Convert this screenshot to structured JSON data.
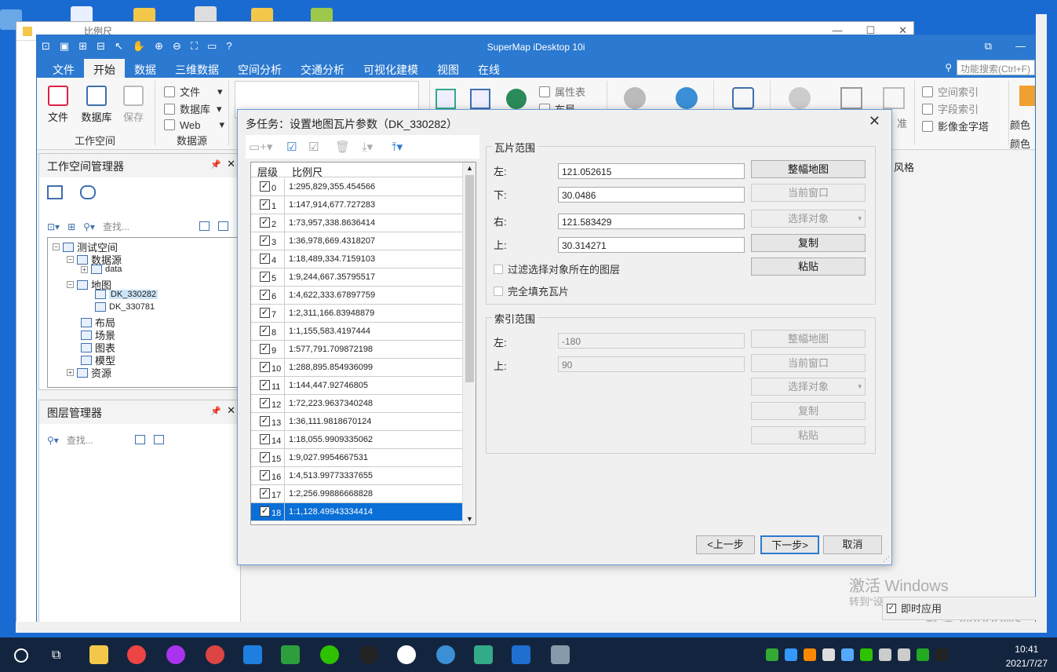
{
  "explorer": {
    "title": "比例尺"
  },
  "app": {
    "title": "SuperMap iDesktop 10i"
  },
  "menu": {
    "tabs": [
      "文件",
      "开始",
      "数据",
      "三维数据",
      "空间分析",
      "交通分析",
      "可视化建模",
      "视图",
      "在线"
    ],
    "search_placeholder": "功能搜索(Ctrl+F)"
  },
  "ribbon": {
    "file": "文件",
    "database": "数据库",
    "save": "保存",
    "group_workspace": "工作空间",
    "ds_file": "文件",
    "ds_database": "数据库",
    "ds_web": "Web",
    "group_datasource": "数据源",
    "attr_table": "属性表",
    "layout": "布局",
    "spatial_index": "空间索引",
    "field_index": "字段索引",
    "image_pyramid": "影像金字塔",
    "color1": "颜色",
    "color2": "颜色",
    "style_label": "风格",
    "partial": "准"
  },
  "workspace_pane": {
    "title": "工作空间管理器",
    "search_placeholder": "查找...",
    "tree": {
      "root": "测试空间",
      "datasources": "数据源",
      "data": "data",
      "maps": "地图",
      "map1": "DK_330282",
      "map2": "DK_330781",
      "layouts": "布局",
      "scenes": "场景",
      "symbols": "图表",
      "models": "模型",
      "resources": "资源"
    }
  },
  "layer_pane": {
    "title": "图层管理器",
    "search_placeholder": "查找..."
  },
  "dialog": {
    "title": "多任务：设置地图瓦片参数（DK_330282）",
    "grid_headers": {
      "level": "层级",
      "scale": "比例尺"
    },
    "rows": [
      {
        "level": "0",
        "scale": "1:295,829,355.454566",
        "checked": "✓"
      },
      {
        "level": "1",
        "scale": "1:147,914,677.727283",
        "checked": "✓"
      },
      {
        "level": "2",
        "scale": "1:73,957,338.8636414",
        "checked": "✓"
      },
      {
        "level": "3",
        "scale": "1:36,978,669.4318207",
        "checked": "✓"
      },
      {
        "level": "4",
        "scale": "1:18,489,334.7159103",
        "checked": "✓"
      },
      {
        "level": "5",
        "scale": "1:9,244,667.35795517",
        "checked": "✓"
      },
      {
        "level": "6",
        "scale": "1:4,622,333.67897759",
        "checked": "✓"
      },
      {
        "level": "7",
        "scale": "1:2,311,166.83948879",
        "checked": "✓"
      },
      {
        "level": "8",
        "scale": "1:1,155,583.4197444",
        "checked": "✓"
      },
      {
        "level": "9",
        "scale": "1:577,791.709872198",
        "checked": "✓"
      },
      {
        "level": "10",
        "scale": "1:288,895.854936099",
        "checked": "✓"
      },
      {
        "level": "11",
        "scale": "1:144,447.92746805",
        "checked": "✓"
      },
      {
        "level": "12",
        "scale": "1:72,223.9637340248",
        "checked": "✓"
      },
      {
        "level": "13",
        "scale": "1:36,111.9818670124",
        "checked": "✓"
      },
      {
        "level": "14",
        "scale": "1:18,055.9909335062",
        "checked": "✓"
      },
      {
        "level": "15",
        "scale": "1:9,027.9954667531",
        "checked": "✓"
      },
      {
        "level": "16",
        "scale": "1:4,513.99773337655",
        "checked": "✓"
      },
      {
        "level": "17",
        "scale": "1:2,256.99886668828",
        "checked": "✓"
      },
      {
        "level": "18",
        "scale": "1:1,128.49943334414",
        "checked": "✓"
      }
    ],
    "tile_range": {
      "title": "瓦片范围",
      "left_label": "左:",
      "left": "121.052615",
      "bottom_label": "下:",
      "bottom": "30.0486",
      "right_label": "右:",
      "right": "121.583429",
      "top_label": "上:",
      "top": "30.314271",
      "btn_full": "整幅地图",
      "btn_current": "当前窗口",
      "btn_select": "选择对象",
      "btn_copy": "复制",
      "btn_paste": "粘贴",
      "chk_filter": "过滤选择对象所在的图层",
      "chk_fill": "完全填充瓦片"
    },
    "index_range": {
      "title": "索引范围",
      "left_label": "左:",
      "left": "-180",
      "top_label": "上:",
      "top": "90",
      "btn_full": "整幅地图",
      "btn_current": "当前窗口",
      "btn_select": "选择对象",
      "btn_copy": "复制",
      "btn_paste": "粘贴"
    },
    "prev": "<上一步",
    "next": "下一步>",
    "cancel": "取消"
  },
  "instant_apply": "即时应用",
  "watermark": {
    "line1": "激活 Windows",
    "line2": "转到“设置”以激活 Windows。",
    "line3": "激活 Windows"
  },
  "clock": {
    "time": "10:41",
    "date": "2021/7/27"
  }
}
